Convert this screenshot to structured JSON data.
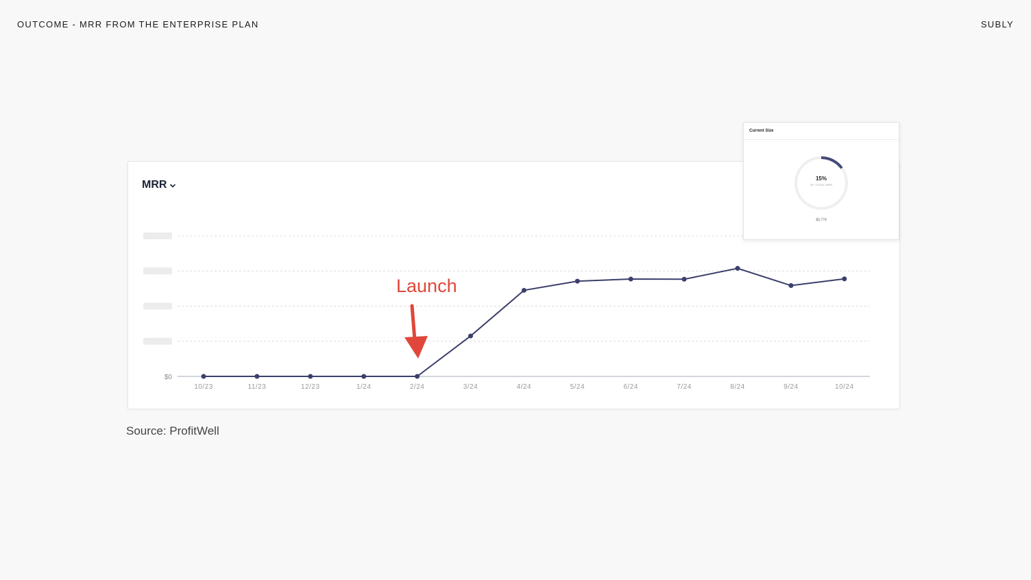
{
  "header": {
    "title": "OUTCOME - MRR FROM THE ENTERPRISE PLAN",
    "brand": "SUBLY"
  },
  "chart_card": {
    "metric_label": "MRR"
  },
  "size_card": {
    "title": "Current Size",
    "percent_label": "15%",
    "subtitle": "OF TOTAL MRR",
    "amount": "$3,774"
  },
  "annotation": {
    "label": "Launch",
    "at": "2/24",
    "color": "#e0473a"
  },
  "source": "Source: ProfitWell",
  "colors": {
    "line": "#3b3f6b",
    "grid": "#dcdcdc",
    "gauge_track": "#efefef",
    "gauge_arc": "#444b78"
  },
  "chart_data": {
    "type": "line",
    "x": [
      "10/23",
      "11/23",
      "12/23",
      "1/24",
      "2/24",
      "3/24",
      "4/24",
      "5/24",
      "6/24",
      "7/24",
      "8/24",
      "9/24",
      "10/24"
    ],
    "series": [
      {
        "values": [
          0,
          0,
          0,
          0,
          0,
          1150,
          2450,
          2710,
          2770,
          2765,
          3075,
          2585,
          2775
        ]
      }
    ],
    "y_ticks": [
      0,
      1000,
      2000,
      3000,
      4000
    ],
    "y_tick_labels": [
      "$0"
    ],
    "ylim": [
      0,
      4000
    ],
    "grid": true,
    "gauge_fraction": 0.15
  }
}
